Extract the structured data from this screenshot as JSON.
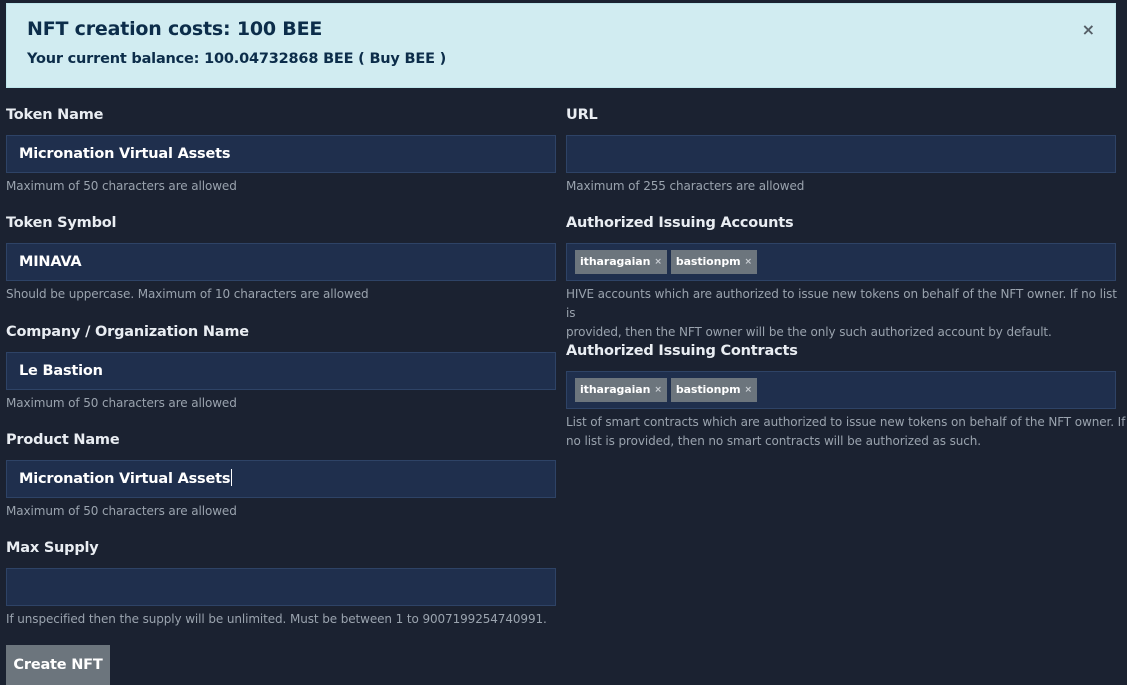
{
  "alert": {
    "title": "NFT creation costs: 100 BEE",
    "balance": "Your current balance: 100.04732868 BEE ( Buy BEE )",
    "close": "×"
  },
  "left": {
    "token_name": {
      "label": "Token Name",
      "value": "Micronation Virtual Assets",
      "help": "Maximum of 50 characters are allowed"
    },
    "token_symbol": {
      "label": "Token Symbol",
      "value": "MINAVA",
      "help": "Should be uppercase. Maximum of 10 characters are allowed"
    },
    "company": {
      "label": "Company / Organization Name",
      "value": "Le Bastion",
      "help": "Maximum of 50 characters are allowed"
    },
    "product": {
      "label": "Product Name",
      "value": "Micronation Virtual Assets",
      "help": "Maximum of 50 characters are allowed"
    },
    "max_supply": {
      "label": "Max Supply",
      "value": "",
      "help": "If unspecified then the supply will be unlimited. Must be between 1 to 9007199254740991."
    }
  },
  "right": {
    "url": {
      "label": "URL",
      "value": "",
      "help": "Maximum of 255 characters are allowed"
    },
    "issuing_accounts": {
      "label": "Authorized Issuing Accounts",
      "tags": [
        "itharagaian",
        "bastionpm"
      ],
      "help_line1": "HIVE accounts which are authorized to issue new tokens on behalf of the NFT owner. If no list is",
      "help_line2": "provided, then the NFT owner will be the only such authorized account by default."
    },
    "issuing_contracts": {
      "label": "Authorized Issuing Contracts",
      "tags": [
        "itharagaian",
        "bastionpm"
      ],
      "help_line1": "List of smart contracts which are authorized to issue new tokens on behalf of the NFT owner. If",
      "help_line2": "no list is provided, then no smart contracts will be authorized as such."
    }
  },
  "create_button": "Create NFT",
  "tag_remove": "×",
  "colors": {
    "background": "#1b2231",
    "alert_bg": "#d1ecf1",
    "input_bg": "#1f2f4d",
    "tag_bg": "#6c757d",
    "button_bg": "#6c757d"
  }
}
